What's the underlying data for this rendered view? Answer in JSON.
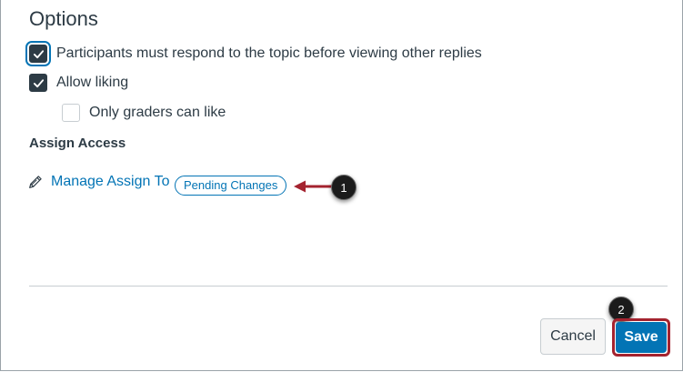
{
  "options": {
    "title": "Options",
    "checkboxes": [
      {
        "label": "Participants must respond to the topic before viewing other replies",
        "checked": true
      },
      {
        "label": "Allow liking",
        "checked": true
      },
      {
        "label": "Only graders can like",
        "checked": false
      }
    ]
  },
  "assign_access": {
    "heading": "Assign Access",
    "link_label": "Manage Assign To",
    "badge": "Pending Changes"
  },
  "callouts": [
    "1",
    "2"
  ],
  "footer": {
    "cancel_label": "Cancel",
    "save_label": "Save"
  },
  "colors": {
    "link": "#0374b5",
    "text": "#2d3b45",
    "callout_arrow": "#a4232f",
    "save_highlight": "#a4232f"
  },
  "icons": {
    "checkbox_checked": "checkmark-icon",
    "link_icon": "pencil-icon"
  }
}
